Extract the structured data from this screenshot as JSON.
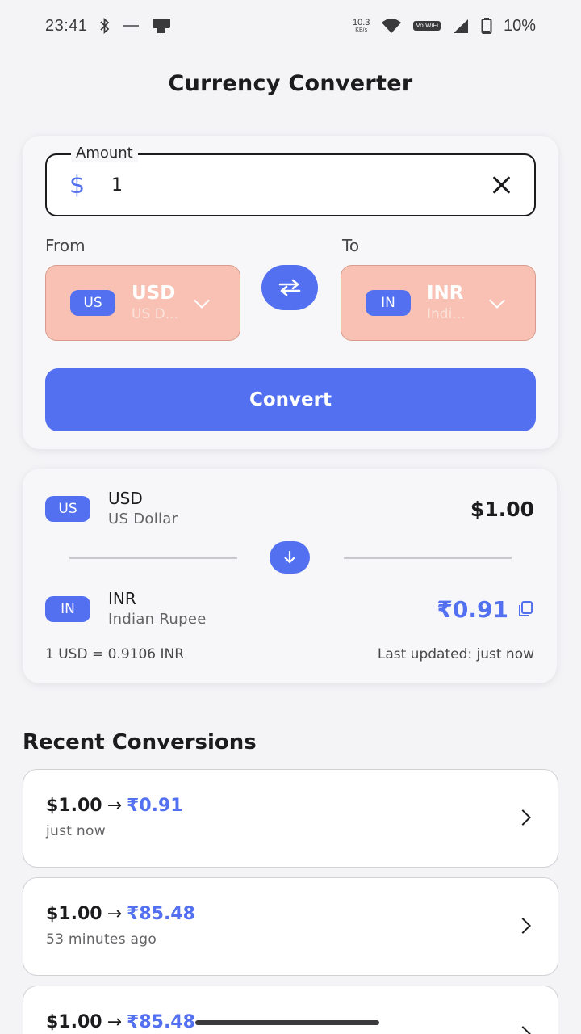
{
  "status_bar": {
    "time": "23:41",
    "net_speed": "10.3",
    "net_speed_unit": "KB/s",
    "volte": "Vo WiFi",
    "battery": "10%"
  },
  "header": {
    "title": "Currency Converter"
  },
  "converter": {
    "amount_label": "Amount",
    "currency_symbol": "$",
    "amount_value": "1",
    "from_label": "From",
    "to_label": "To",
    "from": {
      "flag": "US",
      "code": "USD",
      "name": "US D..."
    },
    "to": {
      "flag": "IN",
      "code": "INR",
      "name": "Indi..."
    },
    "convert_label": "Convert"
  },
  "result": {
    "from": {
      "flag": "US",
      "code": "USD",
      "name": "US Dollar",
      "amount": "$1.00"
    },
    "to": {
      "flag": "IN",
      "code": "INR",
      "name": "Indian Rupee",
      "amount": "₹0.91"
    },
    "rate": "1 USD = 0.9106 INR",
    "updated": "Last updated: just now"
  },
  "recent": {
    "title": "Recent Conversions",
    "items": [
      {
        "from": "$1.00",
        "to": "₹0.91",
        "time": "just now"
      },
      {
        "from": "$1.00",
        "to": "₹85.48",
        "time": "53 minutes ago"
      },
      {
        "from": "$1.00",
        "to": "₹85.48",
        "time": ""
      }
    ]
  },
  "colors": {
    "accent": "#5270f0",
    "select_bg": "#f8c1b3",
    "background": "#f4f4f7"
  },
  "icons": [
    "bluetooth-icon",
    "wifi-icon",
    "signal-icon",
    "battery-icon",
    "dollar-icon",
    "close-icon",
    "swap-icon",
    "chevron-down-icon",
    "arrow-down-icon",
    "copy-icon",
    "chevron-right-icon"
  ]
}
